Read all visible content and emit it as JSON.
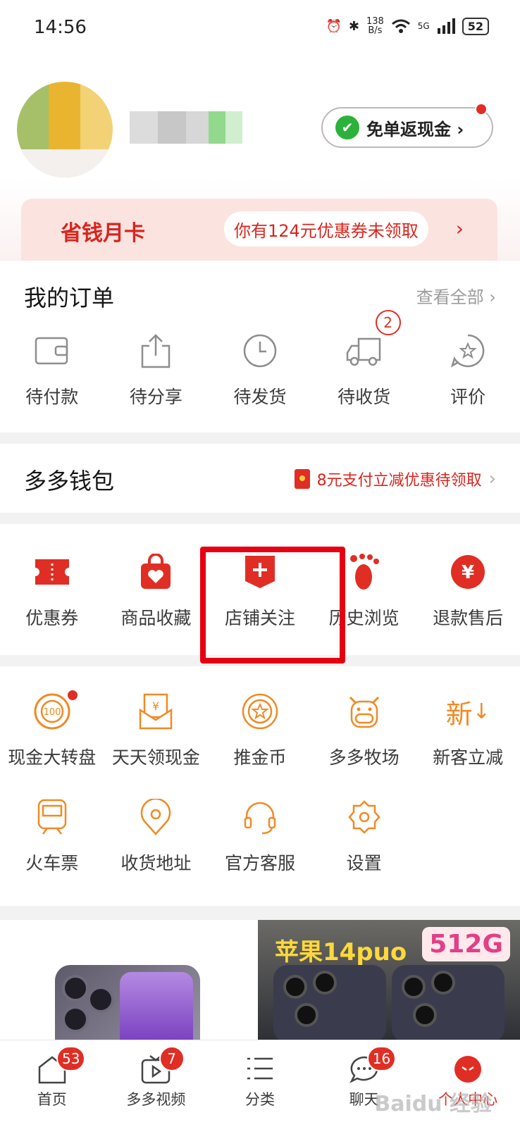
{
  "status_bar": {
    "time": "14:56",
    "network_speed": "138\nB/s",
    "network_type": "5G",
    "battery": "52"
  },
  "profile": {
    "cashback_label": "免单返现金 ›"
  },
  "month_card": {
    "title": "省钱月卡",
    "promo": "你有124元优惠券未领取",
    "chevron": "›"
  },
  "orders": {
    "title": "我的订单",
    "see_all": "查看全部 ›",
    "items": [
      {
        "label": "待付款",
        "icon": "wallet-icon"
      },
      {
        "label": "待分享",
        "icon": "share-icon"
      },
      {
        "label": "待发货",
        "icon": "clock-icon"
      },
      {
        "label": "待收货",
        "icon": "truck-icon",
        "badge": "2"
      },
      {
        "label": "评价",
        "icon": "star-comment-icon"
      }
    ]
  },
  "wallet": {
    "title": "多多钱包",
    "note": "8元支付立减优惠待领取",
    "chevron": "›"
  },
  "shortcuts": [
    {
      "label": "优惠券",
      "icon": "coupon-icon"
    },
    {
      "label": "商品收藏",
      "icon": "bag-heart-icon"
    },
    {
      "label": "店铺关注",
      "icon": "shop-plus-icon"
    },
    {
      "label": "历史浏览",
      "icon": "footprint-icon"
    },
    {
      "label": "退款售后",
      "icon": "refund-icon"
    }
  ],
  "services_row1": [
    {
      "label": "现金大转盘",
      "icon": "wheel-icon",
      "dot": true
    },
    {
      "label": "天天领现金",
      "icon": "cash-envelope-icon"
    },
    {
      "label": "推金币",
      "icon": "coin-icon"
    },
    {
      "label": "多多牧场",
      "icon": "cow-icon"
    },
    {
      "label": "新客立减",
      "icon": "new-discount-icon"
    }
  ],
  "services_row2": [
    {
      "label": "火车票",
      "icon": "train-icon"
    },
    {
      "label": "收货地址",
      "icon": "location-icon"
    },
    {
      "label": "官方客服",
      "icon": "headset-icon"
    },
    {
      "label": "设置",
      "icon": "gear-icon"
    }
  ],
  "icon_texts": {
    "new": "新",
    "yen": "¥",
    "hundred": "100",
    "plus": "+"
  },
  "ads": {
    "right_title": "苹果14puo",
    "right_tag": "512G"
  },
  "tabbar": [
    {
      "label": "首页",
      "icon": "home-icon",
      "badge": "53"
    },
    {
      "label": "多多视频",
      "icon": "video-icon",
      "badge": "7"
    },
    {
      "label": "分类",
      "icon": "category-icon"
    },
    {
      "label": "聊天",
      "icon": "chat-icon",
      "badge": "16"
    },
    {
      "label": "个人中心",
      "icon": "profile-icon",
      "active": true
    }
  ],
  "watermark": "Baidu 经验",
  "colors": {
    "brand_red": "#e02e24",
    "orange_icon": "#f08a24",
    "cashback_green": "#2bb23b"
  }
}
